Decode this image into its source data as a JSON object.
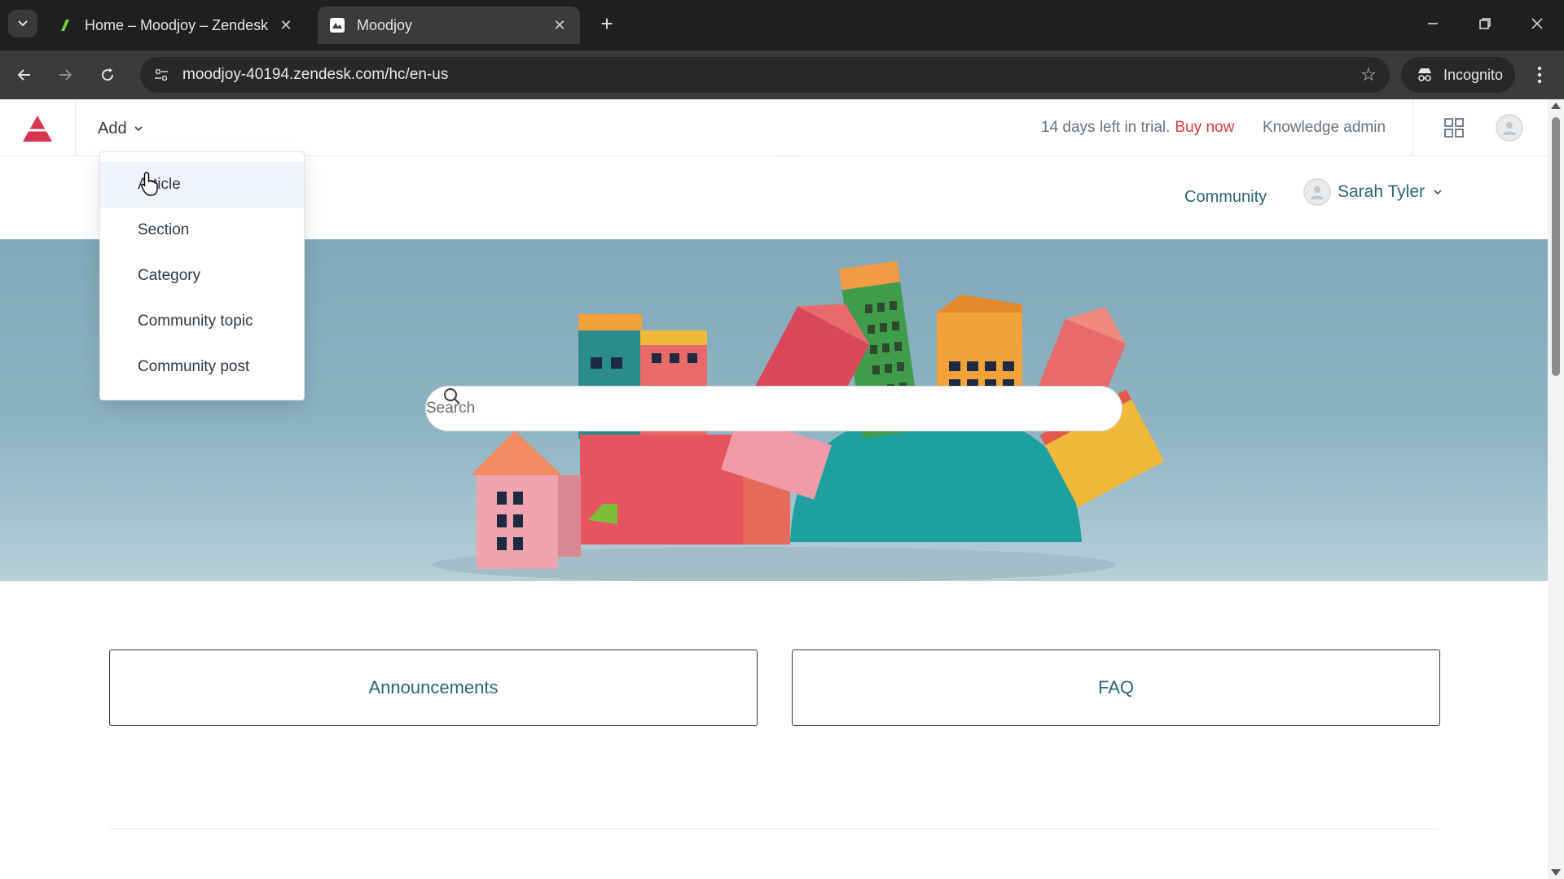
{
  "browser": {
    "tabs": [
      {
        "title": "Home – Moodjoy – Zendesk",
        "active": false
      },
      {
        "title": "Moodjoy",
        "active": true
      }
    ],
    "url": "moodjoy-40194.zendesk.com/hc/en-us",
    "incognito_label": "Incognito"
  },
  "admin_bar": {
    "add_label": "Add",
    "trial_text": "14 days left in trial.",
    "buy_now": "Buy now",
    "knowledge_admin": "Knowledge admin"
  },
  "add_menu": {
    "items": [
      "Article",
      "Section",
      "Category",
      "Community topic",
      "Community post"
    ]
  },
  "header": {
    "community_link": "Community",
    "user_name": "Sarah Tyler"
  },
  "search": {
    "placeholder": "Search"
  },
  "categories": [
    {
      "label": "Announcements"
    },
    {
      "label": "FAQ"
    }
  ],
  "colors": {
    "brand_link": "#2c6472",
    "buy_now": "#d8383e",
    "chrome_bg": "#1f1f1f"
  }
}
